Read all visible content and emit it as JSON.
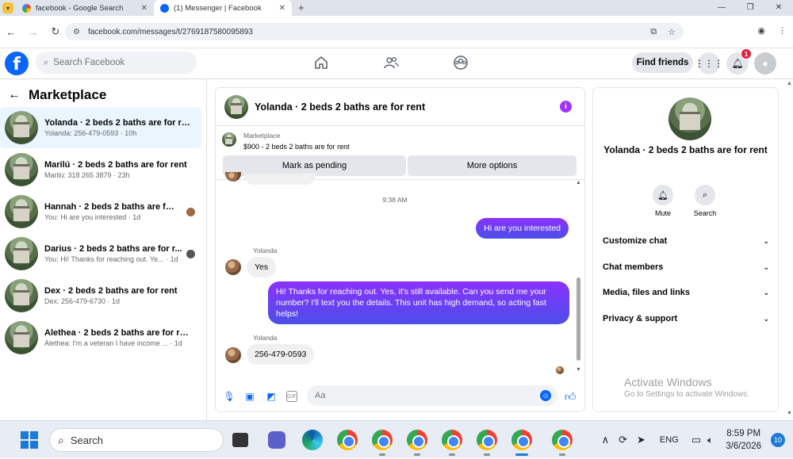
{
  "browser": {
    "tabs": [
      {
        "title": "facebook - Google Search",
        "favicon": "google-icon"
      },
      {
        "title": "(1) Messenger | Facebook",
        "favicon": "facebook-icon",
        "active": true
      }
    ],
    "url": "facebook.com/messages/t/2769187580095893"
  },
  "fb_header": {
    "search_placeholder": "Search Facebook",
    "find_friends": "Find friends",
    "notification_count": "1"
  },
  "left_panel": {
    "title": "Marketplace",
    "conversations": [
      {
        "name": "Yolanda · 2 beds 2 baths are for rent",
        "preview": "Yolanda: 256-479-0593 · 10h",
        "selected": true
      },
      {
        "name": "Marilú · 2 beds 2 baths are for rent",
        "preview": "Marilú: 318 265 3879 · 23h"
      },
      {
        "name": "Hannah · 2 beds 2 baths are for ...",
        "preview": "You: Hi are you interested · 1d"
      },
      {
        "name": "Darius · 2 beds 2 baths are for r...",
        "preview": "You: Hi! Thanks for reaching out. Ye... · 1d"
      },
      {
        "name": "Dex · 2 beds 2 baths are for rent",
        "preview": "Dex: 256-479-6730 · 1d"
      },
      {
        "name": "Alethea · 2 beds 2 baths are for rent",
        "preview": "Alethea: I'm a veteran I have income ... · 1d"
      }
    ]
  },
  "chat": {
    "title": "Yolanda · 2 beds 2 baths are for rent",
    "marketplace_label": "Marketplace",
    "listing": "$900 - 2 beds 2 baths are for rent",
    "mark_pending": "Mark as pending",
    "more_options": "More options",
    "timestamp": "9:38 AM",
    "messages": [
      {
        "from": "me",
        "text": "Hi are you interested"
      },
      {
        "from": "Yolanda",
        "sender_label": "Yolanda",
        "text": "Yes"
      },
      {
        "from": "me",
        "text": "Hi! Thanks for reaching out. Yes, it's still available. Can you send me your number? I'll text you the details. This unit has high demand, so acting fast helps!"
      },
      {
        "from": "Yolanda",
        "sender_label": "Yolanda",
        "text": "256-479-0593"
      }
    ],
    "composer_placeholder": "Aa"
  },
  "right_panel": {
    "title": "Yolanda · 2 beds 2 baths are for rent",
    "actions": [
      {
        "label": "Mute",
        "icon": "bell-icon"
      },
      {
        "label": "Search",
        "icon": "search-icon"
      }
    ],
    "sections": [
      "Customize chat",
      "Chat members",
      "Media, files and links",
      "Privacy & support"
    ]
  },
  "watermark": {
    "line1": "Activate Windows",
    "line2": "Go to Settings to activate Windows."
  },
  "taskbar": {
    "search_label": "Search",
    "language": "ENG",
    "time": "8:59 PM",
    "date": "3/6/2026",
    "notification_count": "10"
  },
  "colors": {
    "fb_blue": "#0866ff",
    "outgoing_bubble": "#8531ff",
    "selected_row": "#ebf5ff"
  }
}
